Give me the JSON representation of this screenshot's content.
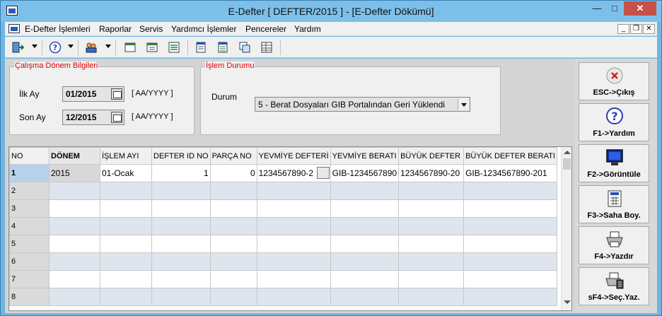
{
  "window": {
    "title": "E-Defter [ DEFTER/2015 ]  - [E-Defter Dökümü]",
    "minimize": "—",
    "maximize": "□",
    "close": "✕"
  },
  "menu": {
    "items": [
      "E-Defter İşlemleri",
      "Raporlar",
      "Servis",
      "Yardımcı İşlemler",
      "Pencereler",
      "Yardım"
    ],
    "mdi_min": "_",
    "mdi_restore": "❐",
    "mdi_close": "✕"
  },
  "toolbar": {
    "icons": [
      "exit-icon",
      "help-icon",
      "users-icon",
      "window-icon",
      "window-detail-icon",
      "list-icon",
      "report-icon",
      "report2-icon",
      "copy-icon",
      "table-icon"
    ]
  },
  "period": {
    "legend": "Çalışma Dönem Bilgileri",
    "start_label": "İlk Ay",
    "start_value": "01/2015",
    "end_label": "Son Ay",
    "end_value": "12/2015",
    "format": "[ AA/YYYY ]"
  },
  "status": {
    "legend": "İşlem Durumu",
    "label": "Durum",
    "value": "5 - Berat Dosyaları GIB Portalından Geri Yüklendi"
  },
  "grid": {
    "columns": [
      "NO",
      "DÖNEM",
      "İŞLEM AYI",
      "DEFTER ID NO",
      "PARÇA NO",
      "YEVMİYE DEFTERİ",
      "YEVMİYE BERATI",
      "BÜYÜK DEFTER",
      "BÜYÜK DEFTER BERATI"
    ],
    "rows": [
      {
        "no": "1",
        "donem": "2015",
        "islem_ayi": "01-Ocak",
        "defter_id": "1",
        "parca_no": "0",
        "yevmiye_defteri": "1234567890-2",
        "yevmiye_berati": "GIB-1234567890",
        "buyuk_defter": "1234567890-20",
        "buyuk_defter_berati": "GIB-1234567890-201"
      },
      {
        "no": "2"
      },
      {
        "no": "3"
      },
      {
        "no": "4"
      },
      {
        "no": "5"
      },
      {
        "no": "6"
      },
      {
        "no": "7"
      },
      {
        "no": "8"
      }
    ]
  },
  "actions": [
    {
      "label": "ESC->Çıkış",
      "icon": "close-icon"
    },
    {
      "label": "F1->Yardım",
      "icon": "help-icon"
    },
    {
      "label": "F2->Görüntüle",
      "icon": "monitor-icon"
    },
    {
      "label": "F3->Saha Boy.",
      "icon": "calculator-icon"
    },
    {
      "label": "F4->Yazdır",
      "icon": "printer-icon"
    },
    {
      "label": "sF4->Seç.Yaz.",
      "icon": "printer-select-icon"
    }
  ]
}
